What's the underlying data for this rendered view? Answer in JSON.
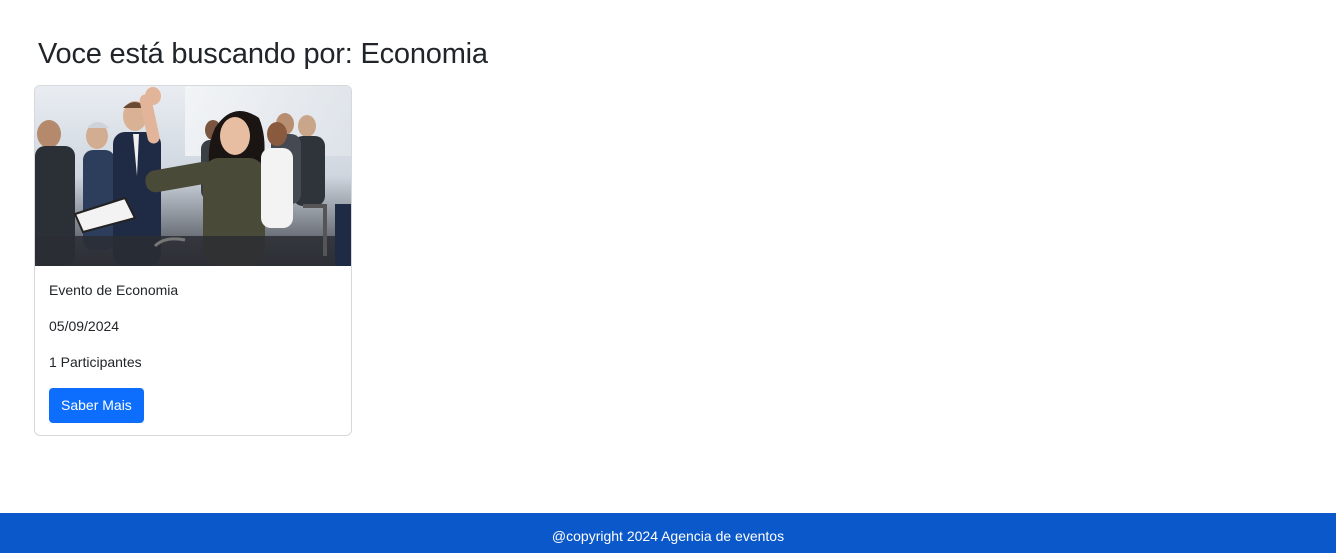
{
  "search": {
    "heading": "Voce está buscando por: Economia"
  },
  "results": [
    {
      "image_description_icon": "audience-photo",
      "title": "Evento de Economia",
      "date": "05/09/2024",
      "participants": "1 Participantes",
      "button_label": "Saber Mais"
    }
  ],
  "footer": {
    "text": "@copyright 2024 Agencia de eventos"
  },
  "colors": {
    "primary_button": "#0d6efd",
    "footer_bg": "#0b58ca"
  }
}
